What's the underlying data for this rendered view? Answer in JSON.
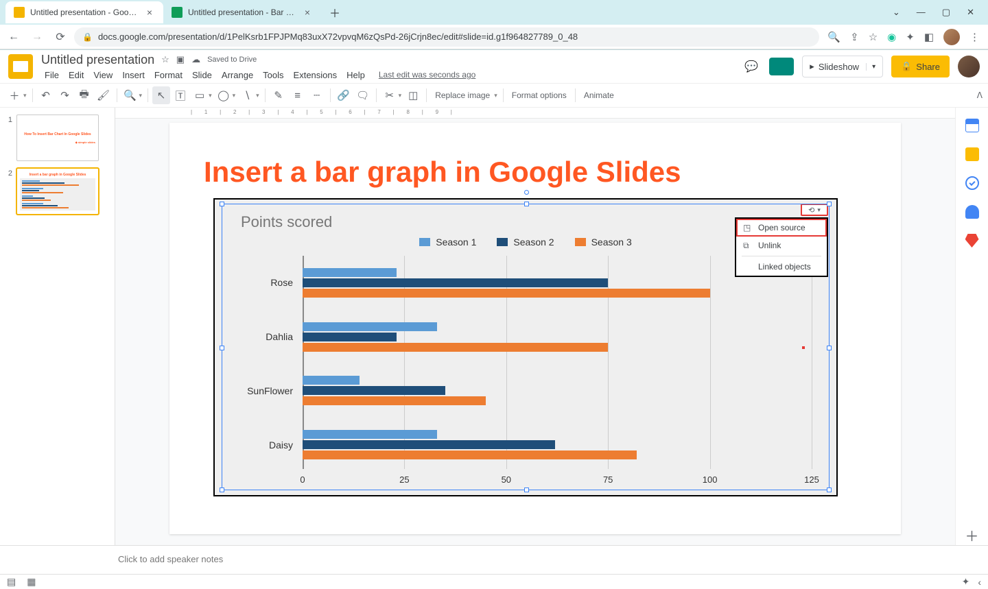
{
  "browser": {
    "tabs": [
      {
        "title": "Untitled presentation - Google Sl",
        "favicon": "#f4b400"
      },
      {
        "title": "Untitled presentation - Bar chart",
        "favicon": "#0f9d58"
      }
    ],
    "url": "docs.google.com/presentation/d/1PelKsrb1FPJPMq83uxX72vpvqM6zQsPd-26jCrjn8ec/edit#slide=id.g1f964827789_0_48"
  },
  "doc": {
    "title": "Untitled presentation",
    "saved": "Saved to Drive",
    "menu": [
      "File",
      "Edit",
      "View",
      "Insert",
      "Format",
      "Slide",
      "Arrange",
      "Tools",
      "Extensions",
      "Help"
    ],
    "last_edit": "Last edit was seconds ago",
    "slideshow": "Slideshow",
    "share": "Share"
  },
  "toolbar": {
    "replace": "Replace image",
    "format": "Format options",
    "animate": "Animate"
  },
  "thumbs": [
    {
      "num": "1",
      "title": "How To Insert Bar Chart In Google Slides"
    },
    {
      "num": "2",
      "title": "Insert a bar graph in Google Slides"
    }
  ],
  "slide": {
    "title": "Insert a bar graph in Google Slides"
  },
  "chart_link_menu": {
    "open": "Open source",
    "unlink": "Unlink",
    "linked": "Linked objects"
  },
  "notes": "Click to add speaker notes",
  "chart_data": {
    "type": "bar",
    "orientation": "horizontal",
    "title": "Points scored",
    "ylabel": "",
    "xlabel": "",
    "xlim": [
      0,
      125
    ],
    "xticks": [
      0,
      25,
      50,
      75,
      100,
      125
    ],
    "categories": [
      "Rose",
      "Dahlia",
      "SunFlower",
      "Daisy"
    ],
    "series": [
      {
        "name": "Season 1",
        "color": "#5b9bd5",
        "values": [
          23,
          33,
          14,
          33
        ]
      },
      {
        "name": "Season 2",
        "color": "#1f4e79",
        "values": [
          75,
          23,
          35,
          62
        ]
      },
      {
        "name": "Season 3",
        "color": "#ed7d31",
        "values": [
          100,
          75,
          45,
          82
        ]
      }
    ]
  }
}
